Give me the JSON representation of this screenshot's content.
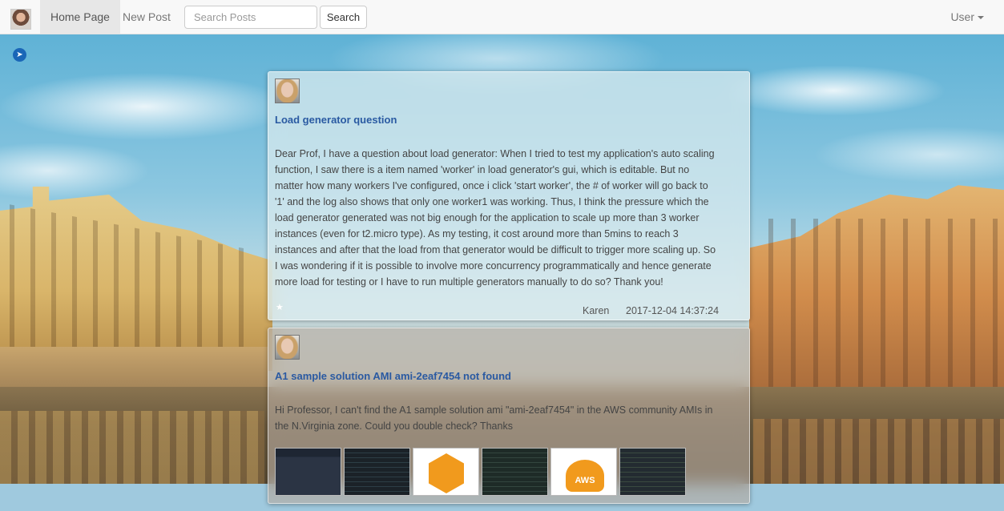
{
  "nav": {
    "home": "Home Page",
    "new_post": "New Post",
    "search_placeholder": "Search Posts",
    "search_button": "Search",
    "user": "User"
  },
  "posts": [
    {
      "title": "Load generator question",
      "body": "Dear Prof, I have a question about load generator: When I tried to test my application's auto scaling function, I saw there is a item named 'worker' in load generator's gui, which is editable. But no matter how many workers I've configured, once i click 'start worker', the # of worker will go back to '1' and the log also shows that only one worker1 was working. Thus, I think the pressure which the load generator generated was not big enough for the application to scale up more than 3 worker instances (even for t2.micro type). As my testing, it cost around more than 5mins to reach 3 instances and after that the load from that generator would be difficult to trigger more scaling up. So I was wondering if it is possible to involve more concurrency programmatically and hence generate more load for testing or I have to run multiple generators manually to do so? Thank you!",
      "author": "Karen",
      "date": "2017-12-04 14:37:24"
    },
    {
      "title": "A1 sample solution AMI ami-2eaf7454 not found",
      "body": "Hi Professor, I can't find the A1 sample solution ami \"ami-2eaf7454\" in the AWS community AMIs in the N.Virginia zone. Could you double check? Thanks",
      "thumb_aws_text": "AWS"
    }
  ]
}
